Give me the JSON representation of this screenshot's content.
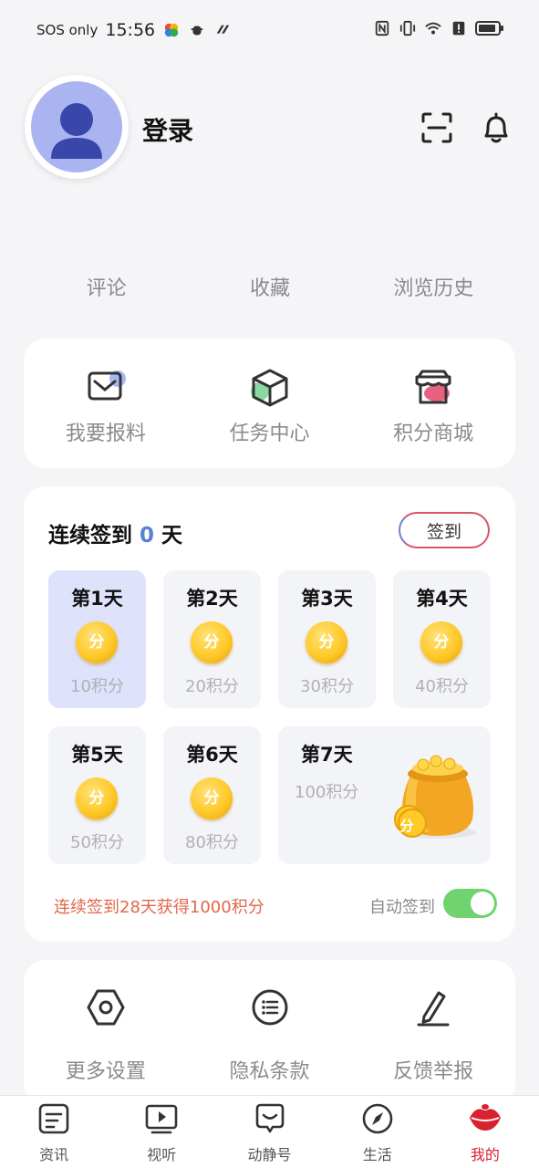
{
  "status_bar": {
    "carrier": "SOS only",
    "time": "15:56"
  },
  "profile": {
    "login_label": "登录"
  },
  "quick_links": [
    "评论",
    "收藏",
    "浏览历史"
  ],
  "tools": [
    {
      "label": "我要报料",
      "icon": "mail-icon"
    },
    {
      "label": "任务中心",
      "icon": "box-icon"
    },
    {
      "label": "积分商城",
      "icon": "store-icon"
    }
  ],
  "signin": {
    "title_prefix": "连续签到 ",
    "days_count": "0",
    "title_suffix": " 天",
    "button_label": "签到",
    "days": [
      {
        "label": "第1天",
        "coin": "分",
        "points": "10积分"
      },
      {
        "label": "第2天",
        "coin": "分",
        "points": "20积分"
      },
      {
        "label": "第3天",
        "coin": "分",
        "points": "30积分"
      },
      {
        "label": "第4天",
        "coin": "分",
        "points": "40积分"
      },
      {
        "label": "第5天",
        "coin": "分",
        "points": "50积分"
      },
      {
        "label": "第6天",
        "coin": "分",
        "points": "80积分"
      },
      {
        "label": "第7天",
        "coin": "分",
        "points": "100积分"
      }
    ],
    "streak_note": "连续签到28天获得1000积分",
    "auto_label": "自动签到",
    "auto_enabled": true
  },
  "settings": [
    {
      "label": "更多设置",
      "icon": "hexagon-settings-icon"
    },
    {
      "label": "隐私条款",
      "icon": "list-circle-icon"
    },
    {
      "label": "反馈举报",
      "icon": "pen-icon"
    }
  ],
  "bottom_nav": [
    {
      "label": "资讯",
      "icon": "news-icon"
    },
    {
      "label": "视听",
      "icon": "video-icon"
    },
    {
      "label": "动静号",
      "icon": "chat-smile-icon"
    },
    {
      "label": "生活",
      "icon": "compass-icon"
    },
    {
      "label": "我的",
      "icon": "profile-lips-icon",
      "active": true
    }
  ],
  "colors": {
    "accent_red": "#d8222f",
    "toggle_green": "#6fd36f",
    "count_blue": "#5a7fd6",
    "note_orange": "#e0674a"
  }
}
